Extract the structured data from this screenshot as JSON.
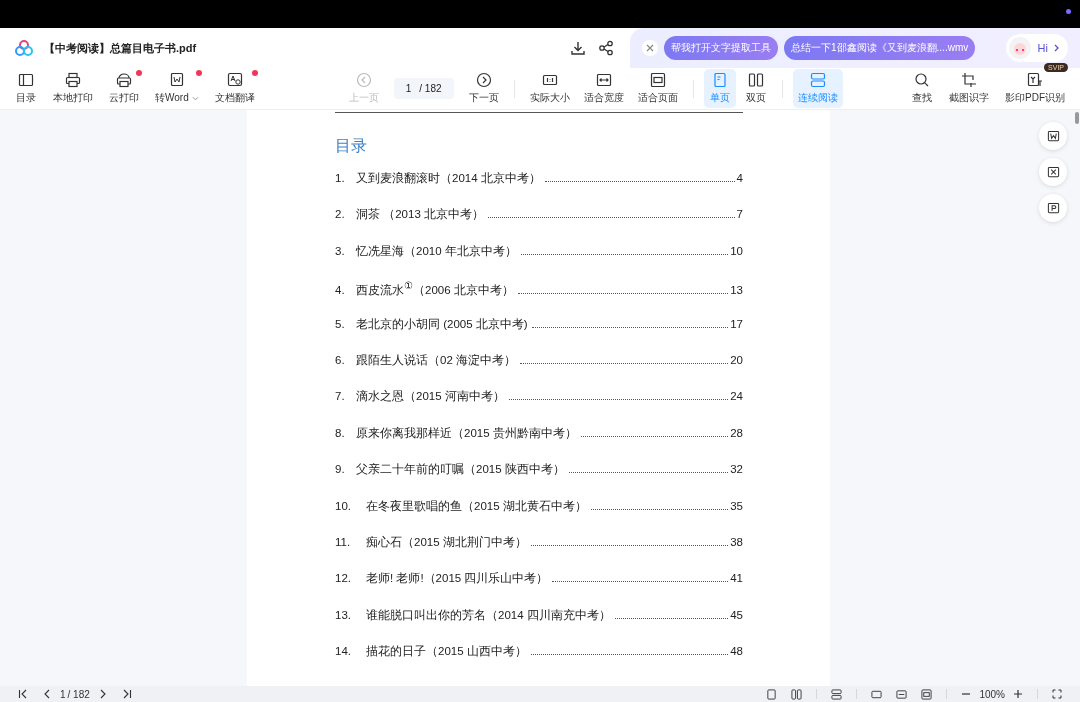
{
  "window": {
    "title": "【中考阅读】总篇目电子书.pdf"
  },
  "assistant": {
    "suggestions": [
      "帮我打开文字提取工具",
      "总结一下1邵鑫阅读《又到麦浪翻....wmv"
    ],
    "greeting": "Hi"
  },
  "toolbar_left": [
    {
      "label": "目录",
      "has_dot": false,
      "dropdown": false
    },
    {
      "label": "本地打印",
      "has_dot": false,
      "dropdown": false
    },
    {
      "label": "云打印",
      "has_dot": true,
      "dropdown": false
    },
    {
      "label": "转Word",
      "has_dot": true,
      "dropdown": true
    },
    {
      "label": "文档翻译",
      "has_dot": true,
      "dropdown": false
    }
  ],
  "pager": {
    "prev": {
      "label": "上一页",
      "disabled": true
    },
    "current": "1",
    "total": "/ 182",
    "next": {
      "label": "下一页",
      "disabled": false
    }
  },
  "view_tools": [
    {
      "label": "实际大小",
      "selected": false
    },
    {
      "label": "适合宽度",
      "selected": false
    },
    {
      "label": "适合页面",
      "selected": false
    },
    {
      "label": "单页",
      "selected": true
    },
    {
      "label": "双页",
      "selected": false
    },
    {
      "label": "连续阅读",
      "selected": true
    }
  ],
  "toolbar_right": [
    {
      "label": "查找"
    },
    {
      "label": "截图识字"
    },
    {
      "label": "影印PDF识别",
      "badge": "SVIP"
    }
  ],
  "document": {
    "heading": "目录",
    "entries": [
      {
        "number": "1.",
        "title": "又到麦浪翻滚时（2014 北京中考）",
        "page": "4"
      },
      {
        "number": "2.",
        "title": "洞茶 （2013 北京中考）",
        "page": "7"
      },
      {
        "number": "3.",
        "title": "忆冼星海（2010 年北京中考）",
        "page": "10"
      },
      {
        "number": "4.",
        "title": "西皮流水$^{①}$（2006 北京中考）",
        "page": "13"
      },
      {
        "number": "5.",
        "title": "老北京的小胡同 (2005 北京中考)",
        "page": "17"
      },
      {
        "number": "6.",
        "title": "跟陌生人说话（02 海淀中考）",
        "page": "20"
      },
      {
        "number": "7.",
        "title": "滴水之恩（2015 河南中考）",
        "page": "24"
      },
      {
        "number": "8.",
        "title": "原来你离我那样近（2015 贵州黔南中考）",
        "page": "28"
      },
      {
        "number": "9.",
        "title": "父亲二十年前的叮嘱（2015 陕西中考）",
        "page": "32"
      },
      {
        "number": "10.",
        "title": "在冬夜里歌唱的鱼（2015 湖北黄石中考）",
        "page": "35"
      },
      {
        "number": "11.",
        "title": "痴心石（2015 湖北荆门中考）",
        "page": "38"
      },
      {
        "number": "12.",
        "title": "老师! 老师!（2015 四川乐山中考）",
        "page": "41"
      },
      {
        "number": "13.",
        "title": "谁能脱口叫出你的芳名（2014 四川南充中考）",
        "page": "45"
      },
      {
        "number": "14.",
        "title": "描花的日子（2015 山西中考）",
        "page": "48"
      }
    ]
  },
  "status_bar": {
    "page": "1",
    "total": "/ 182",
    "zoom": "100%"
  }
}
